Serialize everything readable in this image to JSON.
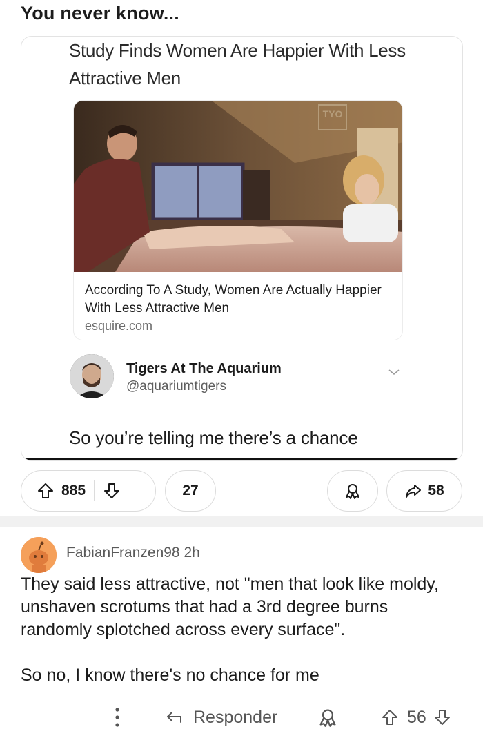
{
  "post": {
    "title": "You never know..."
  },
  "tweet": {
    "headline": "Study Finds Women Are Happier With Less Attractive Men",
    "article": {
      "caption": "According To A Study, Women Are Actually Happier With Less Attractive Men",
      "domain": "esquire.com",
      "watermark_logo": "TYO"
    },
    "author": {
      "name": "Tigers At The Aquarium",
      "handle": "@aquariumtigers"
    },
    "text": "So you’re telling me there’s a chance"
  },
  "actions": {
    "upvotes": "885",
    "comments": "27",
    "shares": "58",
    "icons": [
      "upvote-icon",
      "downvote-icon",
      "award-icon",
      "share-icon"
    ]
  },
  "comment": {
    "author": "FabianFranzen98",
    "time": "2h",
    "paragraphs": [
      "They said less attractive, not \"men that look like moldy, unshaven scrotums that had a 3rd degree burns randomly splotched across every surface\".",
      "So no, I know there's no chance for me"
    ],
    "reply_label": "Responder",
    "votes": "56"
  },
  "colors": {
    "avatar_orange": "#f5a05a",
    "text_dark": "#1c1c1c",
    "text_muted": "#5a5a5a",
    "border": "#dcdcdc"
  }
}
